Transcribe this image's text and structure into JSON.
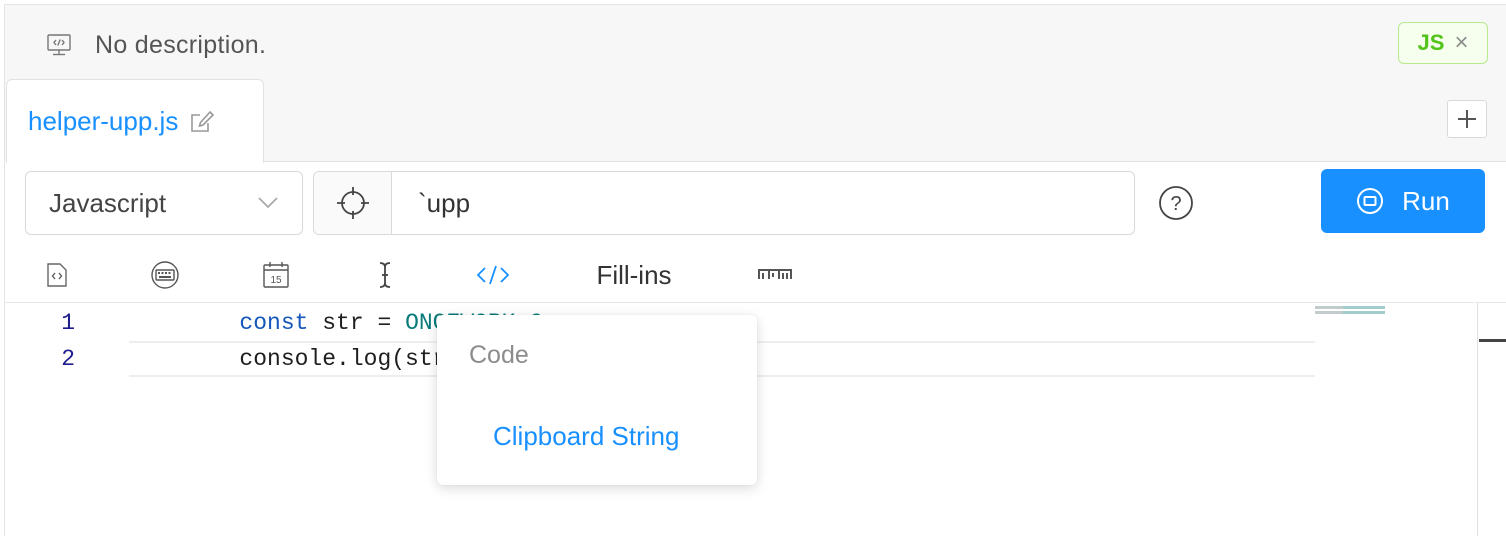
{
  "description": {
    "icon": "code-monitor-icon",
    "text": "No description."
  },
  "language_badge": {
    "label": "JS",
    "close_glyph": "×",
    "color": "#52c41a"
  },
  "tabs": [
    {
      "label": "helper-upp.js",
      "active": true
    }
  ],
  "add_tab_glyph": "+",
  "language_select": {
    "value": "Javascript"
  },
  "abbreviation": {
    "value": "`upp"
  },
  "help_glyph": "?",
  "run_button": {
    "label": "Run",
    "color": "#1890ff"
  },
  "tool_tabs": [
    {
      "icon": "code-file-icon",
      "active": false
    },
    {
      "icon": "keyboard-icon",
      "active": false
    },
    {
      "icon": "calendar-icon",
      "active": false,
      "calendar_day": "15"
    },
    {
      "icon": "text-cursor-icon",
      "active": false
    },
    {
      "icon": "code-brackets-icon",
      "active": true
    },
    {
      "label": "Fill-ins",
      "active": false
    },
    {
      "icon": "npm-icon",
      "active": false
    }
  ],
  "editor": {
    "lines": [
      {
        "number": "1",
        "tokens": [
          {
            "t": "const",
            "c": "kw"
          },
          {
            "t": " str = ",
            "c": "id"
          },
          {
            "t": "ONCEWORK_C",
            "c": "cn"
          }
        ]
      },
      {
        "number": "2",
        "tokens": [
          {
            "t": "console.log(str.toUppe",
            "c": "id"
          }
        ]
      }
    ]
  },
  "dropdown": {
    "group_label": "Code",
    "items": [
      "Clipboard String"
    ]
  }
}
